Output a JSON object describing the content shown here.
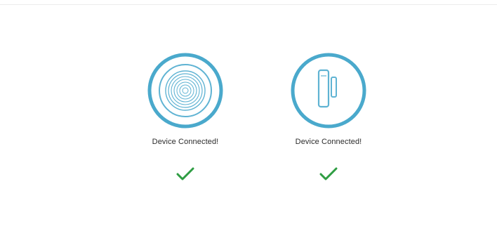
{
  "devices": [
    {
      "icon": "siren-icon",
      "status_text": "Device Connected!",
      "status_icon": "checkmark-icon"
    },
    {
      "icon": "door-sensor-icon",
      "status_text": "Device Connected!",
      "status_icon": "checkmark-icon"
    }
  ],
  "colors": {
    "ring": "#4aa9cc",
    "icon_stroke": "#5fb3d3",
    "check": "#2f9d43",
    "text": "#2b2b2b"
  }
}
